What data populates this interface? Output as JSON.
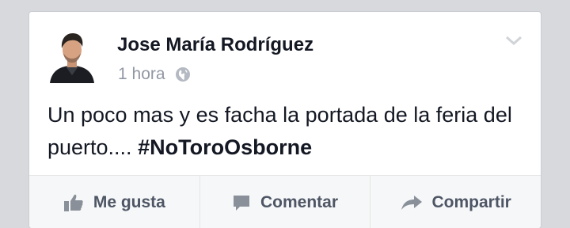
{
  "post": {
    "author": "Jose María Rodríguez",
    "timestamp": "1 hora",
    "privacy_icon": "globe-icon",
    "text_main": "Un poco mas y es facha la portada de la feria del puerto.... ",
    "hashtag": "#NoToroOsborne"
  },
  "actions": {
    "like_label": "Me gusta",
    "like_icon": "thumbs-up-icon",
    "comment_label": "Comentar",
    "comment_icon": "speech-bubble-icon",
    "share_label": "Compartir",
    "share_icon": "share-arrow-icon"
  },
  "colors": {
    "background": "#d7d9dd",
    "card": "#ffffff",
    "text": "#141823",
    "muted": "#9197a3",
    "action_text": "#4e5665"
  }
}
